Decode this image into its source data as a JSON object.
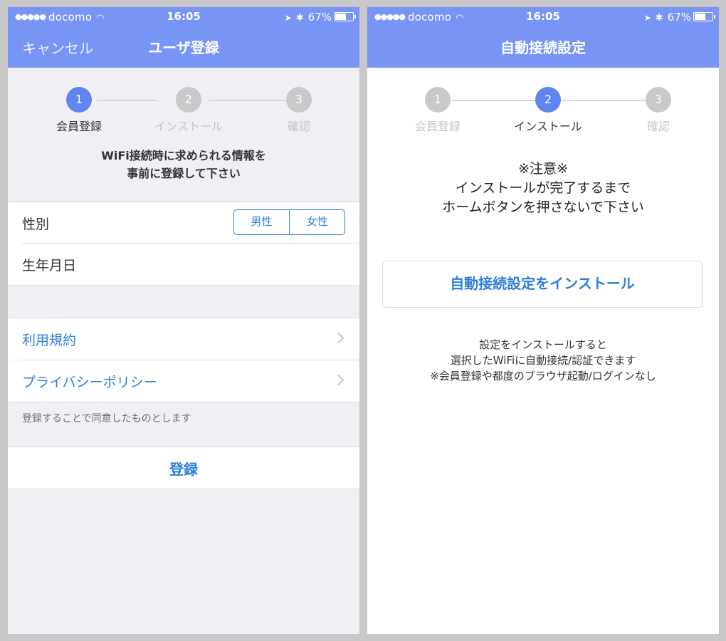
{
  "status": {
    "carrier": "docomo",
    "dots": "●●●●●",
    "time": "16:05",
    "location_icon": "➤",
    "bluetooth_icon": "✱",
    "battery": "67%",
    "battery_level": 0.67
  },
  "left": {
    "nav": {
      "cancel": "キャンセル",
      "title": "ユーザ登録"
    },
    "steps": [
      {
        "num": "1",
        "label": "会員登録"
      },
      {
        "num": "2",
        "label": "インストール"
      },
      {
        "num": "3",
        "label": "確認"
      }
    ],
    "intro_line1": "WiFi接続時に求められる情報を",
    "intro_line2": "事前に登録して下さい",
    "gender_label": "性別",
    "gender_options": [
      "男性",
      "女性"
    ],
    "birthday_label": "生年月日",
    "terms_label": "利用規約",
    "privacy_label": "プライバシーポリシー",
    "agree_note": "登録することで同意したものとします",
    "register_label": "登録"
  },
  "right": {
    "nav": {
      "title": "自動接続設定"
    },
    "steps": [
      {
        "num": "1",
        "label": "会員登録"
      },
      {
        "num": "2",
        "label": "インストール"
      },
      {
        "num": "3",
        "label": "確認"
      }
    ],
    "warning_title": "※注意※",
    "warning_line1": "インストールが完了するまで",
    "warning_line2": "ホームボタンを押さないで下さい",
    "install_button": "自動接続設定をインストール",
    "note_line1": "設定をインストールすると",
    "note_line2": "選択したWiFiに自動接続/認証できます",
    "note_line3": "※会員登録や都度のブラウザ起動/ログインなし"
  },
  "colors": {
    "navbar": "#7895f5",
    "active_step": "#5f85f1",
    "link": "#2f7fd8",
    "background": "#efeff4"
  }
}
